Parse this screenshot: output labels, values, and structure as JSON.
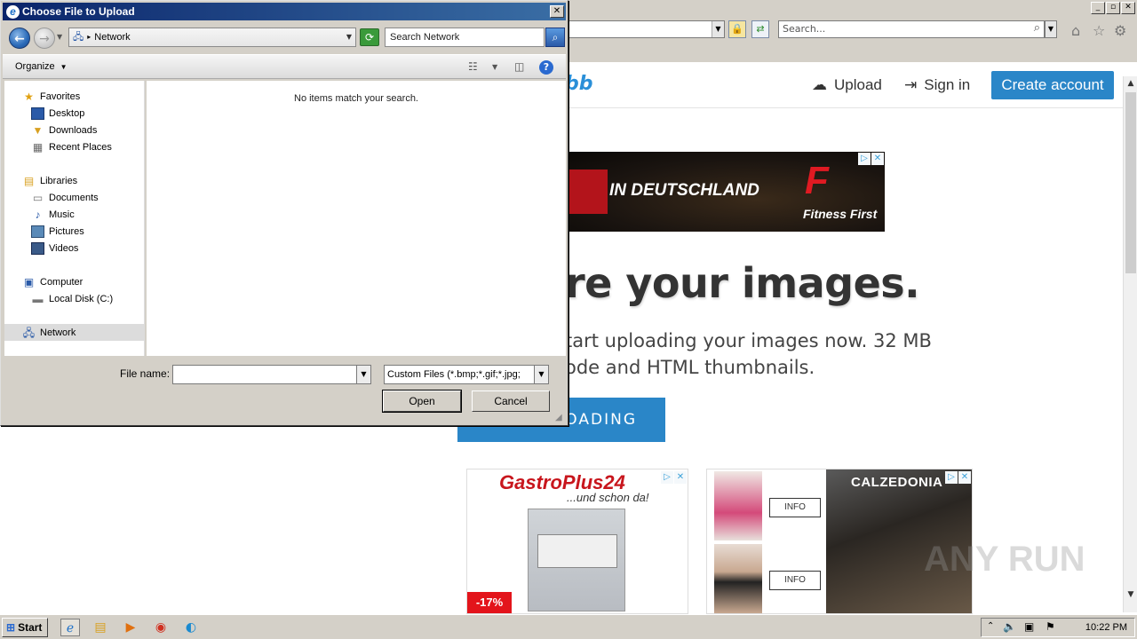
{
  "browser": {
    "address_bar": {
      "value": ""
    },
    "search": {
      "placeholder": "Search..."
    },
    "window_buttons": [
      "_",
      "▫",
      "✕"
    ]
  },
  "site": {
    "logo": "bb",
    "nav": {
      "upload": "Upload",
      "signin": "Sign in",
      "create_account": "Create account"
    },
    "ad_top": {
      "headline": "IN DEUTSCHLAND",
      "brand_mark": "F",
      "brand": "Fitness First"
    },
    "hero": {
      "title": "re your images.",
      "sub1": "tart uploading your images now. 32 MB",
      "sub2": "ode and HTML thumbnails.",
      "button": "OADING"
    },
    "ad_gastro": {
      "logo": "GastroPlus24",
      "tagline": "...und schon da!",
      "badge": "-17%"
    },
    "ad_calzedonia": {
      "logo": "CALZEDONIA",
      "info1": "INFO",
      "info2": "INFO"
    },
    "watermark": "ANY RUN"
  },
  "dialog": {
    "title": "Choose File to Upload",
    "address": "Network",
    "search_value": "Search Network",
    "organize": "Organize",
    "empty_message": "No items match your search.",
    "nav": {
      "favorites": "Favorites",
      "desktop": "Desktop",
      "downloads": "Downloads",
      "recent": "Recent Places",
      "libraries": "Libraries",
      "documents": "Documents",
      "music": "Music",
      "pictures": "Pictures",
      "videos": "Videos",
      "computer": "Computer",
      "local_disk": "Local Disk (C:)",
      "network": "Network"
    },
    "file_name_label": "File name:",
    "file_name_value": "",
    "file_type": "Custom Files (*.bmp;*.gif;*.jpg;",
    "open": "Open",
    "cancel": "Cancel"
  },
  "taskbar": {
    "start": "Start",
    "clock": "10:22 PM"
  },
  "colors": {
    "accent": "#2a86c8",
    "dialog_title": "#0a246a",
    "chrome": "#d4d0c8"
  }
}
